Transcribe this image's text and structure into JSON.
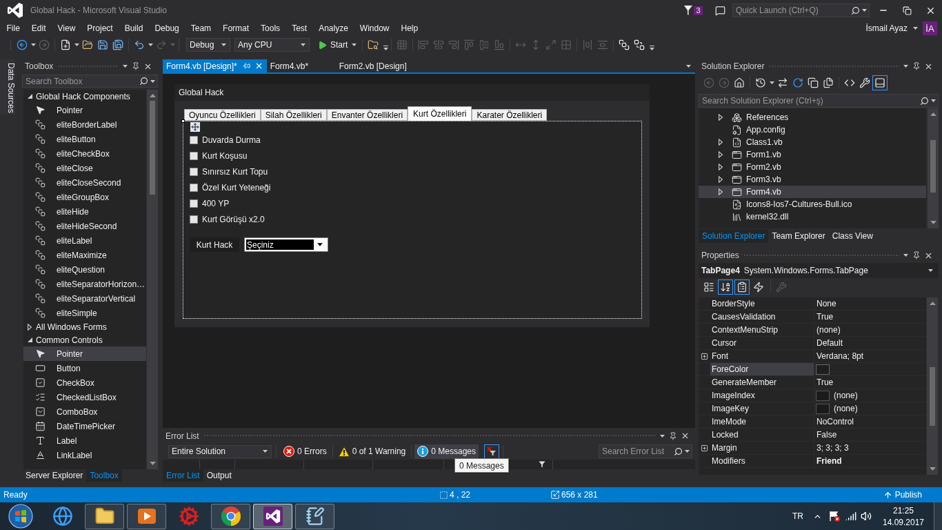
{
  "window": {
    "title": "Global Hack - Microsoft Visual Studio",
    "notifications": "3",
    "quick_launch": {
      "placeholder": "Quick Launch (Ctrl+Q)"
    }
  },
  "menu": [
    "File",
    "Edit",
    "View",
    "Project",
    "Build",
    "Debug",
    "Team",
    "Format",
    "Tools",
    "Test",
    "Analyze",
    "Window",
    "Help"
  ],
  "account": {
    "name": "İsmail Ayaz",
    "initials": "İA"
  },
  "toolbar": [
    [
      {
        "kind": "back",
        "disabled": false
      },
      {
        "kind": "forward",
        "disabled": true
      }
    ],
    [
      {
        "kind": "new-item",
        "disabled": false
      },
      {
        "kind": "open",
        "disabled": false
      },
      {
        "kind": "save",
        "disabled": false
      },
      {
        "kind": "save-all",
        "disabled": false
      }
    ],
    [
      {
        "kind": "undo",
        "disabled": false
      },
      {
        "kind": "redo",
        "disabled": true
      }
    ],
    [
      {
        "kind": "configuration",
        "value": "Debug"
      },
      {
        "kind": "platform",
        "value": "Any CPU"
      },
      {
        "kind": "start",
        "label": "Start"
      }
    ],
    [
      {
        "kind": "find",
        "disabled": false
      },
      {
        "kind": "overflow"
      }
    ],
    [
      {
        "kind": "align-grid",
        "disabled": true
      }
    ],
    [
      {
        "kind": "align-lefts",
        "disabled": true
      },
      {
        "kind": "align-centers",
        "disabled": true
      },
      {
        "kind": "align-rights",
        "disabled": true
      },
      {
        "kind": "align-tops",
        "disabled": true
      },
      {
        "kind": "align-middles",
        "disabled": true
      },
      {
        "kind": "align-bottoms",
        "disabled": true
      }
    ],
    [
      {
        "kind": "same-width",
        "disabled": true
      },
      {
        "kind": "same-height",
        "disabled": true
      },
      {
        "kind": "same-size",
        "disabled": true
      },
      {
        "kind": "size-to-grid",
        "disabled": true
      }
    ],
    [
      {
        "kind": "horizontal-spacing",
        "disabled": true
      },
      {
        "kind": "vertical-spacing",
        "disabled": true
      }
    ],
    [
      {
        "kind": "bring-to-front",
        "disabled": false
      },
      {
        "kind": "send-to-back",
        "disabled": false
      },
      {
        "kind": "overflow"
      }
    ]
  ],
  "data_sources_tab": "Data Sources",
  "toolbox": {
    "title": "Toolbox",
    "search": {
      "placeholder": "Search Toolbox"
    },
    "groups": [
      {
        "label": "Global Hack Components",
        "expanded": true,
        "items": [
          {
            "label": "Pointer",
            "kind": "pointer",
            "selected": false
          },
          {
            "label": "eliteBorderLabel",
            "kind": "component",
            "selected": false
          },
          {
            "label": "eliteButton",
            "kind": "component",
            "selected": false
          },
          {
            "label": "eliteCheckBox",
            "kind": "component",
            "selected": false
          },
          {
            "label": "eliteClose",
            "kind": "component",
            "selected": false
          },
          {
            "label": "eliteCloseSecond",
            "kind": "component",
            "selected": false
          },
          {
            "label": "eliteGroupBox",
            "kind": "component",
            "selected": false
          },
          {
            "label": "eliteHide",
            "kind": "component",
            "selected": false
          },
          {
            "label": "eliteHideSecond",
            "kind": "component",
            "selected": false
          },
          {
            "label": "eliteLabel",
            "kind": "component",
            "selected": false
          },
          {
            "label": "eliteMaximize",
            "kind": "component",
            "selected": false
          },
          {
            "label": "eliteQuestion",
            "kind": "component",
            "selected": false
          },
          {
            "label": "eliteSeparatorHorizon…",
            "kind": "component",
            "selected": false
          },
          {
            "label": "eliteSeparatorVertical",
            "kind": "component",
            "selected": false
          },
          {
            "label": "eliteSimple",
            "kind": "component",
            "selected": false
          }
        ]
      },
      {
        "label": "All Windows Forms",
        "expanded": false
      },
      {
        "label": "Common Controls",
        "expanded": true,
        "items": [
          {
            "label": "Pointer",
            "kind": "pointer",
            "selected": true
          },
          {
            "label": "Button",
            "kind": "button",
            "selected": false
          },
          {
            "label": "CheckBox",
            "kind": "checkbox",
            "selected": false
          },
          {
            "label": "CheckedListBox",
            "kind": "checkedlistbox",
            "selected": false
          },
          {
            "label": "ComboBox",
            "kind": "combobox",
            "selected": false
          },
          {
            "label": "DateTimePicker",
            "kind": "datetimepicker",
            "selected": false
          },
          {
            "label": "Label",
            "kind": "label",
            "selected": false
          },
          {
            "label": "LinkLabel",
            "kind": "linklabel",
            "selected": false
          }
        ]
      }
    ]
  },
  "toolbox_tabs": [
    {
      "label": "Server Explorer",
      "selected": false
    },
    {
      "label": "Toolbox",
      "selected": true
    }
  ],
  "documents": [
    {
      "title": "Form4.vb [Design]*",
      "selected": true
    },
    {
      "title": "Form4.vb*",
      "selected": false
    },
    {
      "title": "Form2.vb [Design]",
      "selected": false
    }
  ],
  "designer": {
    "form_title": "Global Hack",
    "tabs": [
      {
        "label": "Oyuncu Özellikleri",
        "selected": false
      },
      {
        "label": "Silah Özellikleri",
        "selected": false
      },
      {
        "label": "Envanter Özellikleri",
        "selected": false
      },
      {
        "label": "Kurt Özellikleri",
        "selected": true
      },
      {
        "label": "Karater Özellikleri",
        "selected": false
      }
    ],
    "checkboxes": [
      {
        "label": "Duvarda Durma",
        "checked": false
      },
      {
        "label": "Kurt Koşusu",
        "checked": false
      },
      {
        "label": "Sınırsız Kurt Topu",
        "checked": false
      },
      {
        "label": "Özel Kurt Yeteneği",
        "checked": false
      },
      {
        "label": "400 YP",
        "checked": false
      },
      {
        "label": "Kurt Görüşü x2.0",
        "checked": false
      }
    ],
    "combo": {
      "label": "Kurt Hack",
      "value": "Şeçiniz"
    }
  },
  "error_list": {
    "title": "Error List",
    "scope": "Entire Solution",
    "filters": [
      {
        "kind": "error",
        "label": "0 Errors",
        "highlighted": false
      },
      {
        "kind": "warning",
        "label": "0 of 1 Warning",
        "highlighted": false
      },
      {
        "kind": "message",
        "label": "0 Messages",
        "highlighted": true
      }
    ],
    "clear_filter": {
      "on": true
    },
    "search": {
      "placeholder": "Search Error List"
    },
    "tooltip": "0 Messages"
  },
  "bottom_tabs": [
    {
      "label": "Error List",
      "selected": true
    },
    {
      "label": "Output",
      "selected": false
    }
  ],
  "solution_explorer": {
    "title": "Solution Explorer",
    "toolbar": [
      [
        {
          "kind": "back",
          "disabled": true,
          "on": false
        },
        {
          "kind": "forward",
          "disabled": true,
          "on": false
        },
        {
          "kind": "home",
          "disabled": false,
          "on": false
        }
      ],
      [
        {
          "kind": "history",
          "disabled": false,
          "on": false
        },
        {
          "kind": "sync",
          "disabled": false,
          "on": false
        },
        {
          "kind": "refresh",
          "disabled": false,
          "on": false
        },
        {
          "kind": "collapse",
          "disabled": false,
          "on": false
        },
        {
          "kind": "show-all",
          "disabled": false,
          "on": false
        }
      ],
      [
        {
          "kind": "view-code",
          "disabled": false,
          "on": false
        },
        {
          "kind": "properties",
          "disabled": false,
          "on": false
        },
        {
          "kind": "preview",
          "disabled": false,
          "on": true
        }
      ]
    ],
    "search": {
      "placeholder": "Search Solution Explorer (Ctrl+ş)"
    },
    "items": [
      {
        "label": "References",
        "kind": "references",
        "expanded": false,
        "selected": false
      },
      {
        "label": "App.config",
        "kind": "config",
        "selected": false
      },
      {
        "label": "Class1.vb",
        "kind": "class",
        "expanded": false,
        "selected": false
      },
      {
        "label": "Form1.vb",
        "kind": "form",
        "expanded": false,
        "selected": false
      },
      {
        "label": "Form2.vb",
        "kind": "form",
        "expanded": false,
        "selected": false
      },
      {
        "label": "Form3.vb",
        "kind": "form",
        "expanded": false,
        "selected": false
      },
      {
        "label": "Form4.vb",
        "kind": "form",
        "expanded": false,
        "selected": true
      },
      {
        "label": "Icons8-Ios7-Cultures-Bull.ico",
        "kind": "icon-file",
        "selected": false
      },
      {
        "label": "kernel32.dll",
        "kind": "dll",
        "selected": false
      }
    ]
  },
  "right_tabs": [
    {
      "label": "Solution Explorer",
      "selected": true
    },
    {
      "label": "Team Explorer",
      "selected": false
    },
    {
      "label": "Class View",
      "selected": false
    }
  ],
  "properties": {
    "title": "Properties",
    "object": {
      "name": "TabPage4",
      "type": "System.Windows.Forms.TabPage"
    },
    "toolbar": [
      [
        {
          "kind": "categorized",
          "disabled": false,
          "on": false
        },
        {
          "kind": "alphabetical",
          "disabled": false,
          "on": true
        },
        {
          "kind": "property-sheet",
          "disabled": false,
          "on": true
        },
        {
          "kind": "events",
          "disabled": false,
          "on": false
        }
      ],
      [
        {
          "kind": "property-pages",
          "disabled": true,
          "on": false
        }
      ]
    ],
    "rows": [
      {
        "name": "BorderStyle",
        "kind": "text",
        "value": "None",
        "changed": false,
        "selected": false
      },
      {
        "name": "CausesValidation",
        "kind": "text",
        "value": "True",
        "changed": false,
        "selected": false
      },
      {
        "name": "ContextMenuStrip",
        "kind": "text",
        "value": "(none)",
        "changed": false,
        "selected": false
      },
      {
        "name": "Cursor",
        "kind": "text",
        "value": "Default",
        "changed": false,
        "selected": false
      },
      {
        "name": "Font",
        "kind": "text",
        "value": "Verdana; 8pt",
        "changed": false,
        "selected": false,
        "expanded": false
      },
      {
        "name": "ForeColor",
        "kind": "color",
        "color": "#1e1e1e",
        "selected": true
      },
      {
        "name": "GenerateMember",
        "kind": "text",
        "value": "True",
        "changed": false,
        "selected": false
      },
      {
        "name": "ImageIndex",
        "kind": "image",
        "value": "(none)",
        "changed": false,
        "selected": false
      },
      {
        "name": "ImageKey",
        "kind": "image",
        "value": "(none)",
        "changed": false,
        "selected": false
      },
      {
        "name": "ImeMode",
        "kind": "text",
        "value": "NoControl",
        "changed": false,
        "selected": false
      },
      {
        "name": "Locked",
        "kind": "text",
        "value": "False",
        "changed": false,
        "selected": false
      },
      {
        "name": "Margin",
        "kind": "text",
        "value": "3; 3; 3; 3",
        "changed": false,
        "selected": false,
        "expanded": false
      },
      {
        "name": "Modifiers",
        "kind": "text",
        "value": "Friend",
        "changed": true,
        "selected": false
      }
    ]
  },
  "status_bar": {
    "text": "Ready",
    "position": "4 , 22",
    "size": "656 x 281",
    "publish": "Publish"
  },
  "taskbar": {
    "apps": [
      {
        "kind": "browser",
        "running": false,
        "active": false
      },
      {
        "kind": "files",
        "running": true,
        "active": false
      },
      {
        "kind": "media",
        "running": true,
        "active": false
      },
      {
        "kind": "game",
        "running": false,
        "active": false
      },
      {
        "kind": "web",
        "running": true,
        "active": false
      },
      {
        "kind": "ide",
        "running": true,
        "active": true
      },
      {
        "kind": "notepad",
        "running": true,
        "active": false
      }
    ],
    "language": "TR",
    "time": "21:25",
    "date": "14.09.2017"
  }
}
